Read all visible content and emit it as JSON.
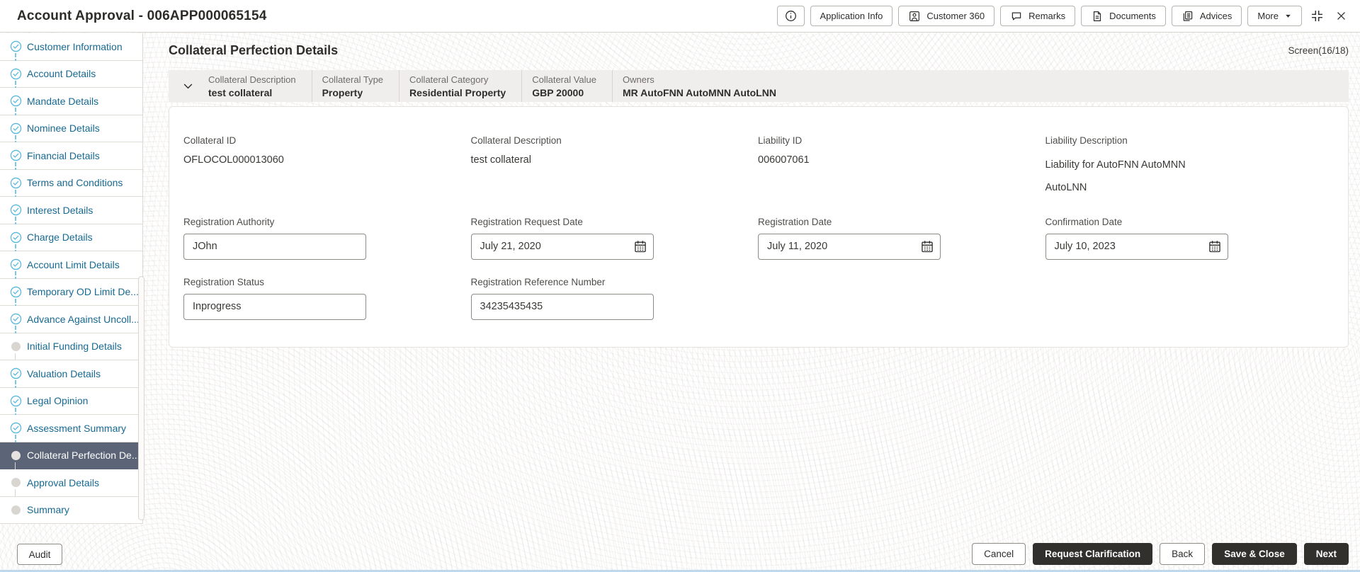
{
  "window": {
    "title": "Account Approval - 006APP000065154"
  },
  "toolbar": {
    "application_info": "Application Info",
    "customer_360": "Customer 360",
    "remarks": "Remarks",
    "documents": "Documents",
    "advices": "Advices",
    "more": "More"
  },
  "icons": {
    "info": "info-icon",
    "customer_360": "person-badge-icon",
    "remarks": "speech-bubble-icon",
    "documents": "document-icon",
    "advices": "stacked-pages-icon",
    "more_caret": "caret-down-icon",
    "collapse": "collapse-corners-icon",
    "close": "close-x-icon",
    "accordion": "chevron-down-icon",
    "date": "calendar-icon",
    "step_done": "check-circle-icon",
    "step_pending": "dot-icon"
  },
  "sidebar": {
    "audit_label": "Audit",
    "items": [
      {
        "label": "Customer Information",
        "state": "done"
      },
      {
        "label": "Account Details",
        "state": "done"
      },
      {
        "label": "Mandate Details",
        "state": "done"
      },
      {
        "label": "Nominee Details",
        "state": "done"
      },
      {
        "label": "Financial Details",
        "state": "done"
      },
      {
        "label": "Terms and Conditions",
        "state": "done"
      },
      {
        "label": "Interest Details",
        "state": "done"
      },
      {
        "label": "Charge Details",
        "state": "done"
      },
      {
        "label": "Account Limit Details",
        "state": "done"
      },
      {
        "label": "Temporary OD Limit De...",
        "state": "done"
      },
      {
        "label": "Advance Against Uncoll...",
        "state": "done"
      },
      {
        "label": "Initial Funding Details",
        "state": "pending"
      },
      {
        "label": "Valuation Details",
        "state": "done"
      },
      {
        "label": "Legal Opinion",
        "state": "done"
      },
      {
        "label": "Assessment Summary",
        "state": "done"
      },
      {
        "label": "Collateral Perfection De...",
        "state": "active"
      },
      {
        "label": "Approval Details",
        "state": "pending"
      },
      {
        "label": "Summary",
        "state": "pending"
      }
    ]
  },
  "main": {
    "title": "Collateral Perfection Details",
    "screen_counter": "Screen(16/18)",
    "accordion": {
      "columns": [
        {
          "label": "Collateral Description",
          "value": "test collateral"
        },
        {
          "label": "Collateral Type",
          "value": "Property"
        },
        {
          "label": "Collateral Category",
          "value": "Residential Property"
        },
        {
          "label": "Collateral Value",
          "value": "GBP 20000"
        },
        {
          "label": "Owners",
          "value": "MR AutoFNN AutoMNN AutoLNN"
        }
      ]
    },
    "fields": {
      "collateral_id": {
        "label": "Collateral ID",
        "value": "OFLOCOL000013060"
      },
      "collateral_description": {
        "label": "Collateral Description",
        "value": "test collateral"
      },
      "liability_id": {
        "label": "Liability ID",
        "value": "006007061"
      },
      "liability_description": {
        "label": "Liability Description",
        "value": "Liability for AutoFNN AutoMNN AutoLNN"
      },
      "registration_authority": {
        "label": "Registration Authority",
        "value": "JOhn"
      },
      "registration_request_date": {
        "label": "Registration Request Date",
        "value": "July 21, 2020"
      },
      "registration_date": {
        "label": "Registration Date",
        "value": "July 11, 2020"
      },
      "confirmation_date": {
        "label": "Confirmation Date",
        "value": "July 10, 2023"
      },
      "registration_status": {
        "label": "Registration Status",
        "value": "Inprogress"
      },
      "registration_reference_number": {
        "label": "Registration Reference Number",
        "value": "34235435435"
      }
    }
  },
  "footer": {
    "cancel": "Cancel",
    "request_clarification": "Request Clarification",
    "back": "Back",
    "save_close": "Save & Close",
    "next": "Next"
  },
  "colors": {
    "accent_blue": "#176992",
    "check_blue": "#57b7dc",
    "active_step_bg": "#5c6577",
    "dark_button_bg": "#32302c",
    "accordion_header_bg": "#f0eeec"
  }
}
